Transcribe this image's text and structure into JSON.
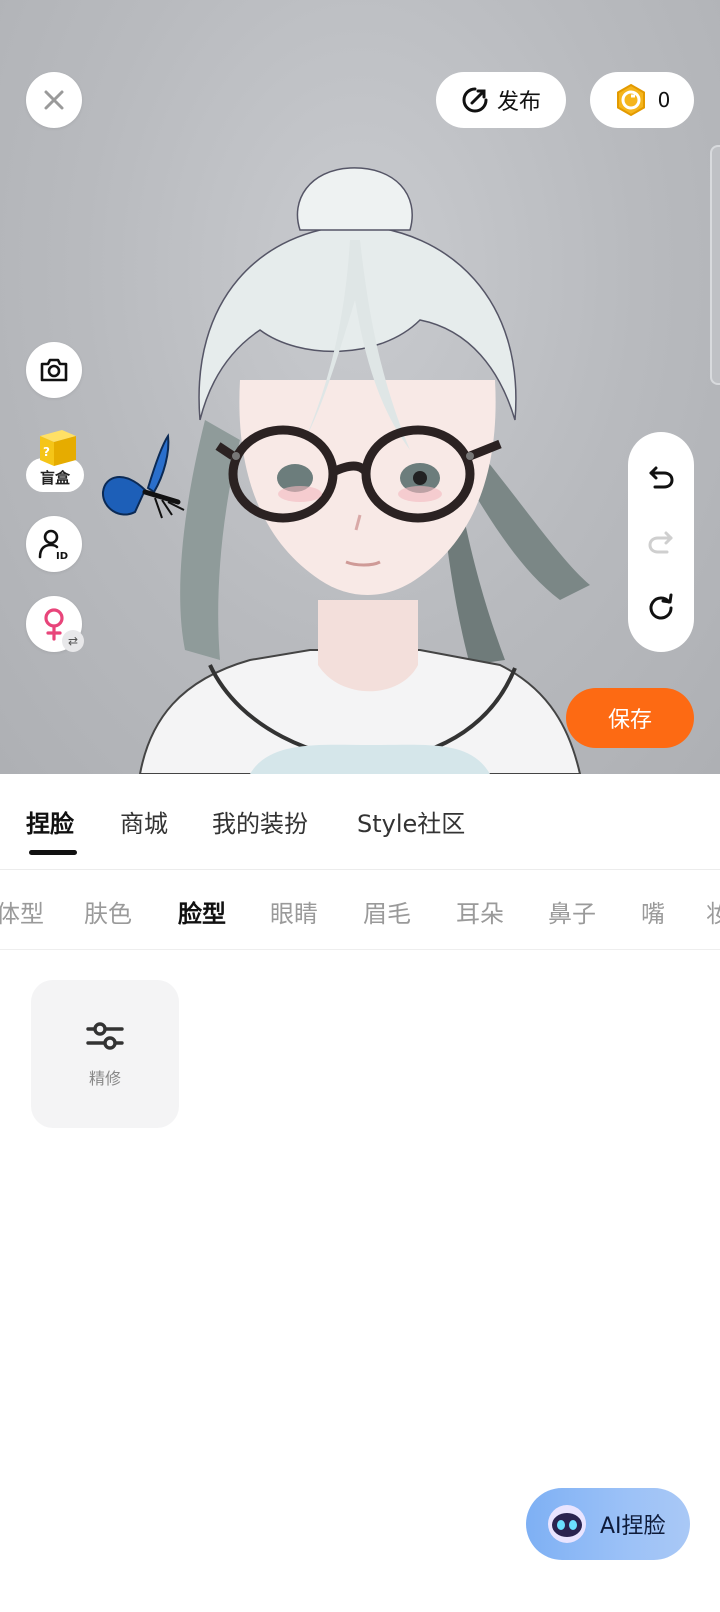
{
  "header": {
    "publish_label": "发布",
    "coins": "0"
  },
  "left_tools": {
    "blindbox_label": "盲盒"
  },
  "save_label": "保存",
  "main_tabs": [
    {
      "label": "捏脸",
      "active": true
    },
    {
      "label": "商城",
      "active": false
    },
    {
      "label": "我的装扮",
      "active": false
    },
    {
      "label": "Style社区",
      "active": false
    }
  ],
  "sub_tabs": [
    {
      "label": "体型",
      "active": false
    },
    {
      "label": "肤色",
      "active": false
    },
    {
      "label": "脸型",
      "active": true
    },
    {
      "label": "眼睛",
      "active": false
    },
    {
      "label": "眉毛",
      "active": false
    },
    {
      "label": "耳朵",
      "active": false
    },
    {
      "label": "鼻子",
      "active": false
    },
    {
      "label": "嘴",
      "active": false
    },
    {
      "label": "妆",
      "active": false
    }
  ],
  "refine_label": "精修",
  "ai_button_label": "AI捏脸",
  "colors": {
    "accent_orange": "#fd6a13",
    "coin_gold": "#f5b51c",
    "gender_pink": "#e8457a",
    "ai_blue": "#8fb9f6"
  },
  "icons": [
    "close-icon",
    "publish-icon",
    "coin-icon",
    "camera-icon",
    "blindbox-icon",
    "id-icon",
    "female-icon",
    "undo-icon",
    "redo-icon",
    "reset-icon",
    "sliders-icon",
    "ai-robot-icon"
  ]
}
